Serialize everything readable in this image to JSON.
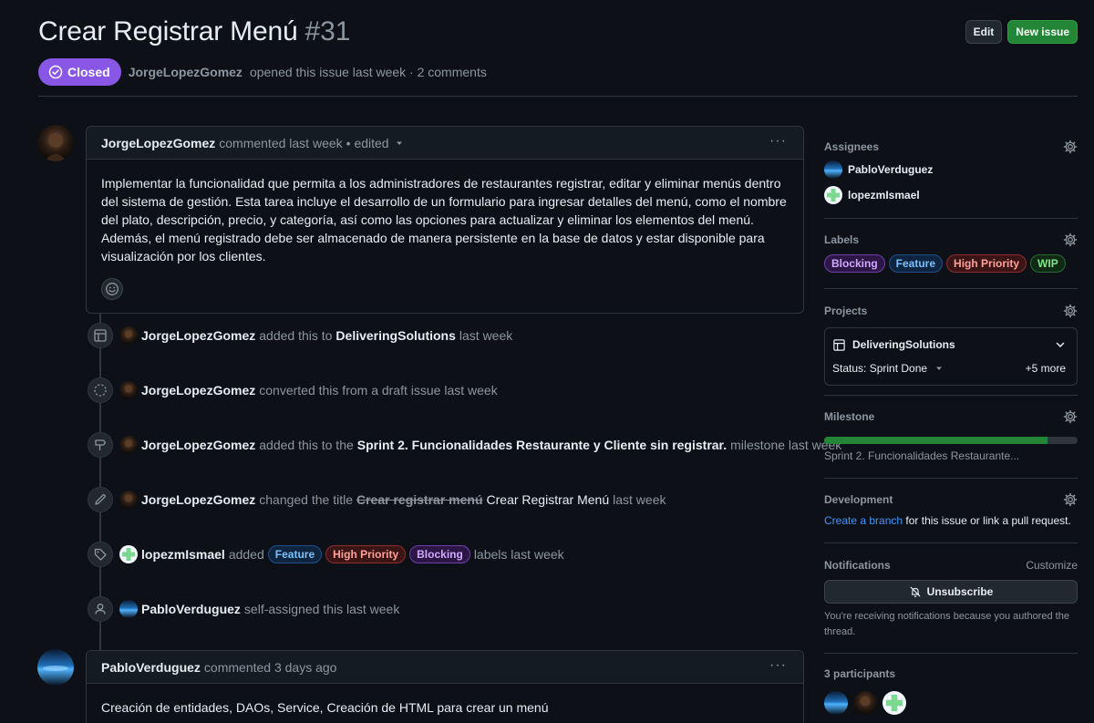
{
  "issue": {
    "title": "Crear Registrar Menú",
    "number": "#31",
    "state": "Closed",
    "author": "JorgeLopezGomez",
    "meta_text": "opened this issue last week · 2 comments"
  },
  "actions": {
    "edit_label": "Edit",
    "new_issue_label": "New issue"
  },
  "comments": [
    {
      "author": "JorgeLopezGomez",
      "meta": "commented last week",
      "edited": "• edited",
      "body": "Implementar la funcionalidad que permita a los administradores de restaurantes registrar, editar y eliminar menús dentro del sistema de gestión. Esta tarea incluye el desarrollo de un formulario para ingresar detalles del menú, como el nombre del plato, descripción, precio, y categoría, así como las opciones para actualizar y eliminar los elementos del menú. Además, el menú registrado debe ser almacenado de manera persistente en la base de datos y estar disponible para visualización por los clientes."
    },
    {
      "author": "PabloVerduguez",
      "meta": "commented 3 days ago",
      "body": "Creación de entidades, DAOs, Service, Creación de HTML para crear un menú"
    }
  ],
  "events": [
    {
      "icon": "table-icon",
      "actor": "JorgeLopezGomez",
      "pre": "added this to",
      "target": "DeliveringSolutions",
      "post": "last week"
    },
    {
      "icon": "draft-icon",
      "actor": "JorgeLopezGomez",
      "pre": "converted this from a draft issue last week"
    },
    {
      "icon": "milestone-icon",
      "actor": "JorgeLopezGomez",
      "pre": "added this to the",
      "target": "Sprint 2. Funcionalidades Restaurante y Cliente sin registrar.",
      "post": "milestone last week"
    },
    {
      "icon": "pencil-icon",
      "actor": "JorgeLopezGomez",
      "pre": "changed the title",
      "old_title": "Crear registrar menú",
      "new_title": "Crear Registrar Menú",
      "post": "last week"
    },
    {
      "icon": "tag-icon",
      "actor": "lopezmIsmael",
      "pre": "added",
      "labels": [
        "Feature",
        "High Priority",
        "Blocking"
      ],
      "post": "labels last week"
    },
    {
      "icon": "person-icon",
      "actor": "PabloVerduguez",
      "pre": "self-assigned this last week"
    }
  ],
  "sidebar": {
    "assignees": {
      "heading": "Assignees",
      "people": [
        "PabloVerduguez",
        "lopezmIsmael"
      ]
    },
    "labels": {
      "heading": "Labels",
      "items": [
        "Blocking",
        "Feature",
        "High Priority",
        "WIP"
      ]
    },
    "projects": {
      "heading": "Projects",
      "name": "DeliveringSolutions",
      "status": "Status: Sprint Done",
      "more": "+5 more"
    },
    "milestone": {
      "heading": "Milestone",
      "name": "Sprint 2. Funcionalidades Restaurante...",
      "progress_percent": 88
    },
    "development": {
      "heading": "Development",
      "link": "Create a branch",
      "text": "for this issue or link a pull request."
    },
    "notifications": {
      "heading": "Notifications",
      "customize": "Customize",
      "button": "Unsubscribe",
      "note": "You're receiving notifications because you authored the thread."
    },
    "participants": {
      "heading": "3 participants"
    }
  },
  "colors": {
    "closed": "#8957e5",
    "blocking": "#d2a8ff",
    "feature": "#79c0ff",
    "high_priority": "#ffa198",
    "wip": "#7ee787"
  }
}
